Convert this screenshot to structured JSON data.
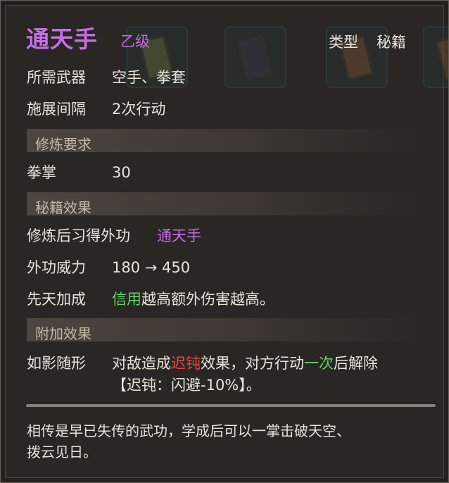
{
  "header": {
    "skill_name": "通天手",
    "grade": "乙级",
    "type_label": "类型",
    "type_value": "秘籍"
  },
  "attributes": [
    {
      "label": "所需武器",
      "value": "空手、拳套"
    },
    {
      "label": "施展间隔",
      "value": "2次行动"
    }
  ],
  "sections": {
    "training_req": "修炼要求",
    "book_effect": "秘籍效果",
    "extra_effect": "附加效果"
  },
  "training_req": {
    "label": "拳掌",
    "value": "30"
  },
  "book_effect": {
    "learn_label": "修炼后习得外功",
    "learn_value": "通天手",
    "power_label": "外功威力",
    "power_value": "180 → 450",
    "innate_label": "先天加成",
    "innate_highlight": "信用",
    "innate_rest": "越高额外伤害越高。"
  },
  "extra_effect": {
    "label": "如影随形",
    "part1": "对敌造成",
    "debuff": "迟钝",
    "part2": "效果，对方行动",
    "count": "一次",
    "part3": "后解除",
    "line2": "【迟钝：闪避-10%】。"
  },
  "flavor": {
    "line1": "相传是早已失传的武功，学成后可以一掌击破天空、",
    "line2": "拨云见日。"
  },
  "colors": {
    "legendary_purple": "#c46ee6",
    "debuff_red": "#f0453f",
    "highlight_green": "#5ed86a",
    "text": "#e8e4dc"
  }
}
